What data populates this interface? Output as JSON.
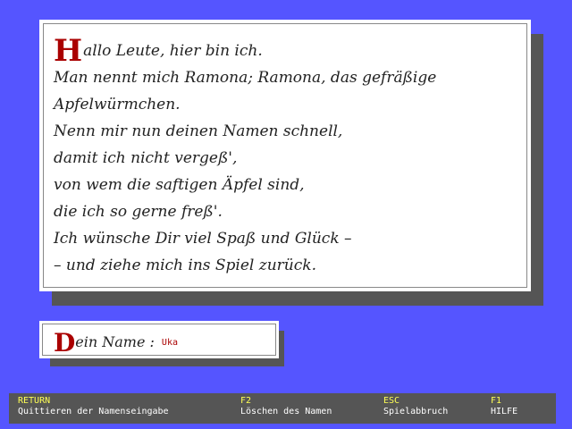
{
  "poem": {
    "first_initial": "H",
    "first_rest": "allo Leute, hier bin ich.",
    "lines": [
      "Man nennt mich Ramona; Ramona, das gefräßige",
      "Apfelwürmchen.",
      "Nenn mir nun deinen Namen schnell,",
      "damit ich nicht vergeß',",
      "von wem die saftigen Äpfel sind,",
      "die ich so gerne freß'.",
      "Ich wünsche Dir viel Spaß und Glück –",
      "– und ziehe mich ins Spiel zurück."
    ]
  },
  "name_entry": {
    "label_initial": "D",
    "label_rest": "ein Name :",
    "value": "Uka"
  },
  "status_bar": {
    "keys": [
      {
        "key": "RETURN",
        "desc": "Quittieren der Namenseingabe"
      },
      {
        "key": "F2",
        "desc": "Löschen des Namen"
      },
      {
        "key": "ESC",
        "desc": "Spielabbruch"
      },
      {
        "key": "F1",
        "desc": "HILFE"
      }
    ]
  },
  "colors": {
    "background": "#5555ff",
    "panel": "#ffffff",
    "shadow": "#555555",
    "initial_red": "#aa0000",
    "key_yellow": "#ffff55"
  }
}
